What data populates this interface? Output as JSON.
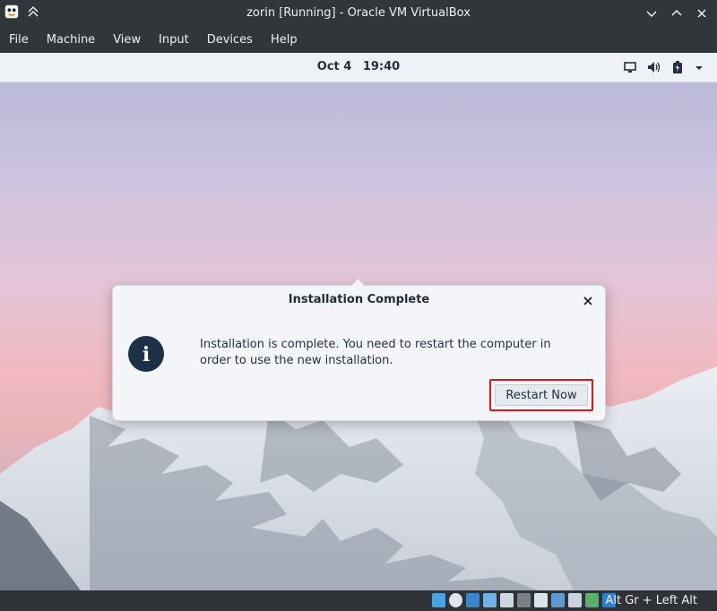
{
  "window": {
    "title": "zorin [Running] - Oracle VM VirtualBox"
  },
  "menubar": {
    "items": [
      "File",
      "Machine",
      "View",
      "Input",
      "Devices",
      "Help"
    ]
  },
  "guest_topbar": {
    "date": "Oct 4",
    "time": "19:40"
  },
  "dialog": {
    "title": "Installation Complete",
    "close_label": "×",
    "info_glyph": "i",
    "message": "Installation is complete. You need to restart the computer in order to use the new installation.",
    "restart_label": "Restart Now"
  },
  "statusbar": {
    "host_key": "Alt Gr + Left Alt"
  },
  "colors": {
    "highlight": "#d9161c",
    "dialog_icon": "#1c3148"
  }
}
